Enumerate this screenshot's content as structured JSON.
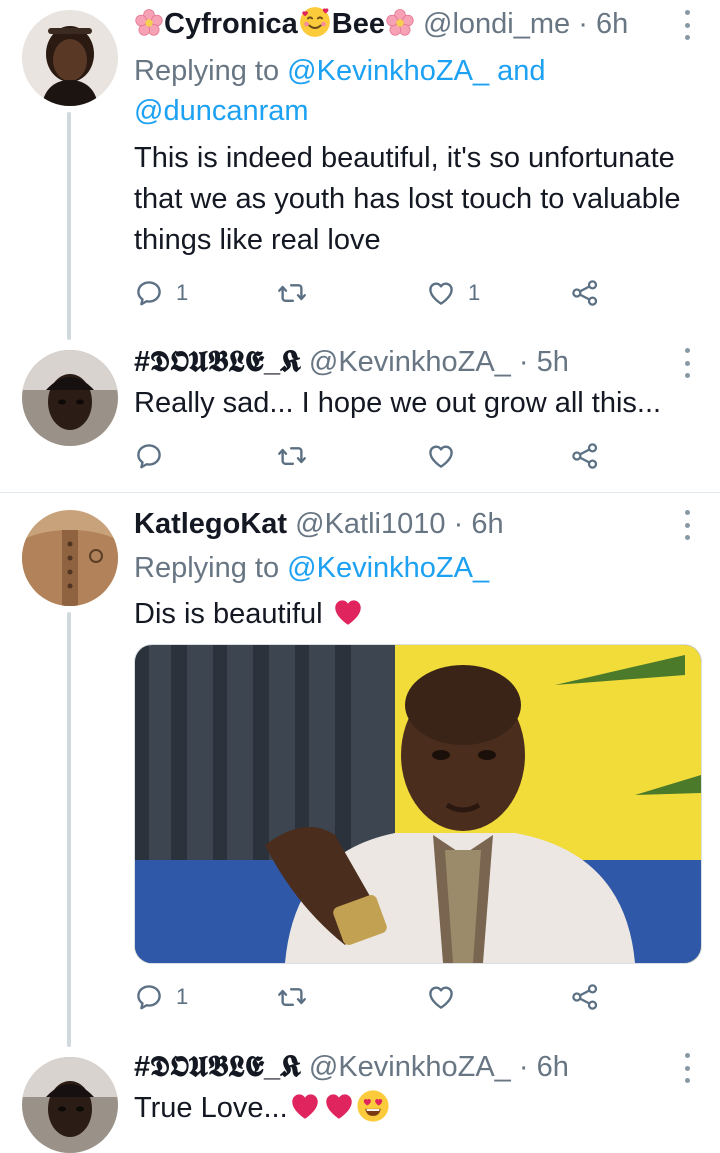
{
  "tweets": [
    {
      "name": "Cyfronica",
      "name_mid": "Bee",
      "handle": "@londi_me",
      "dot": "·",
      "time": "6h",
      "replying_prefix": "Replying to",
      "replying_user1": "@KevinkhoZA_",
      "replying_and": "and",
      "replying_user2": "@duncanram",
      "text": "This is indeed beautiful, it's so unfortunate that we as youth has lost touch to valuable things like real love",
      "reply_count": "1",
      "like_count": "1"
    },
    {
      "name": "#𝕯𝕺𝖀𝕭𝕷𝕰_𝕶",
      "handle": "@KevinkhoZA_",
      "dot": "·",
      "time": "5h",
      "text": "Really sad... I hope we out grow all this..."
    },
    {
      "name": "KatlegoKat",
      "handle": "@Katli1010",
      "dot": "·",
      "time": "6h",
      "replying_prefix": "Replying to",
      "replying_user1": "@KevinkhoZA_",
      "text": "Dis is beautiful",
      "reply_count": "1"
    },
    {
      "name": "#𝕯𝕺𝖀𝕭𝕷𝕰_𝕶",
      "handle": "@KevinkhoZA_",
      "dot": "·",
      "time": "6h",
      "text": "True Love..."
    }
  ],
  "icons": {
    "reply": "reply-icon",
    "retweet": "retweet-icon",
    "like": "heart-icon",
    "share": "share-icon",
    "more": "more-vertical-icon"
  },
  "colors": {
    "link": "#1da1f2",
    "secondary_text": "#687684",
    "heart_red": "#e0245e",
    "thread_line": "#cfd9de"
  }
}
